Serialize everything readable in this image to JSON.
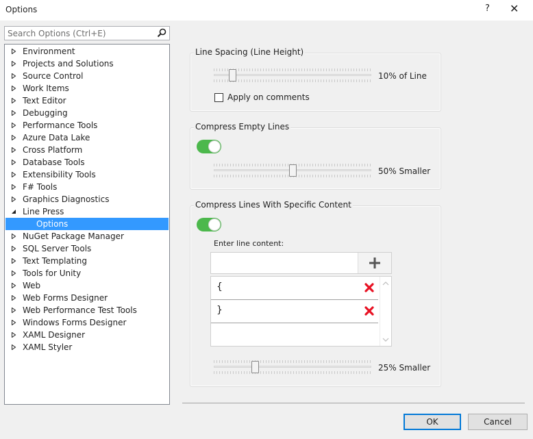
{
  "window": {
    "title": "Options",
    "help_label": "?",
    "close_label": "✕"
  },
  "search": {
    "placeholder": "Search Options (Ctrl+E)",
    "icon": "search-icon"
  },
  "tree": {
    "items": [
      {
        "label": "Environment",
        "expanded": false
      },
      {
        "label": "Projects and Solutions",
        "expanded": false
      },
      {
        "label": "Source Control",
        "expanded": false
      },
      {
        "label": "Work Items",
        "expanded": false
      },
      {
        "label": "Text Editor",
        "expanded": false
      },
      {
        "label": "Debugging",
        "expanded": false
      },
      {
        "label": "Performance Tools",
        "expanded": false
      },
      {
        "label": "Azure Data Lake",
        "expanded": false
      },
      {
        "label": "Cross Platform",
        "expanded": false
      },
      {
        "label": "Database Tools",
        "expanded": false
      },
      {
        "label": "Extensibility Tools",
        "expanded": false
      },
      {
        "label": "F# Tools",
        "expanded": false
      },
      {
        "label": "Graphics Diagnostics",
        "expanded": false
      },
      {
        "label": "Line Press",
        "expanded": true
      },
      {
        "label": "Options",
        "child": true,
        "selected": true
      },
      {
        "label": "NuGet Package Manager",
        "expanded": false
      },
      {
        "label": "SQL Server Tools",
        "expanded": false
      },
      {
        "label": "Text Templating",
        "expanded": false
      },
      {
        "label": "Tools for Unity",
        "expanded": false
      },
      {
        "label": "Web",
        "expanded": false
      },
      {
        "label": "Web Forms Designer",
        "expanded": false
      },
      {
        "label": "Web Performance Test Tools",
        "expanded": false
      },
      {
        "label": "Windows Forms Designer",
        "expanded": false
      },
      {
        "label": "XAML Designer",
        "expanded": false
      },
      {
        "label": "XAML Styler",
        "expanded": false
      }
    ]
  },
  "line_spacing": {
    "title": "Line Spacing (Line Height)",
    "value_label": "10% of Line",
    "slider_fraction": 0.1,
    "apply_on_comments_label": "Apply on comments",
    "apply_on_comments_checked": false
  },
  "compress_empty": {
    "title": "Compress Empty Lines",
    "enabled": true,
    "value_label": "50% Smaller",
    "slider_fraction": 0.5
  },
  "compress_specific": {
    "title": "Compress Lines With Specific Content",
    "enabled": true,
    "enter_label": "Enter line content:",
    "input_value": "",
    "add_icon": "plus-icon",
    "entries": [
      {
        "text": "{"
      },
      {
        "text": "}"
      }
    ],
    "delete_icon": "delete-x-icon",
    "value_label": "25% Smaller",
    "slider_fraction": 0.25
  },
  "buttons": {
    "ok_label": "OK",
    "cancel_label": "Cancel"
  },
  "colors": {
    "selection": "#3399ff",
    "toggle_on": "#4cb84c",
    "delete": "#e81123",
    "default_button": "#0078d7"
  }
}
